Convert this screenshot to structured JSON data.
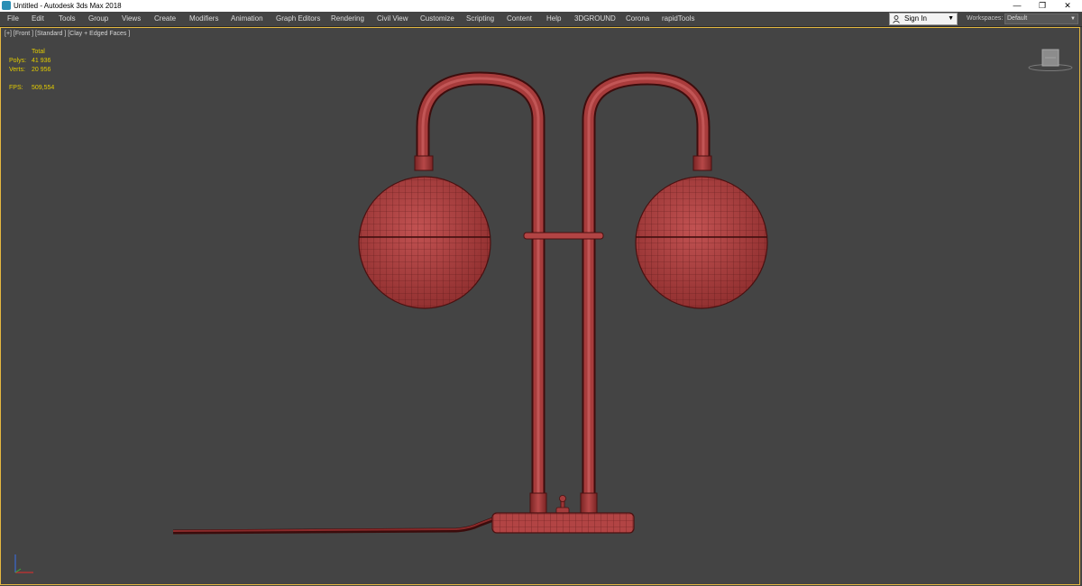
{
  "window": {
    "title": "Untitled - Autodesk 3ds Max 2018",
    "controls": {
      "minimize": "—",
      "restore": "❐",
      "close": "✕"
    }
  },
  "menu": {
    "items": [
      "File",
      "Edit",
      "Tools",
      "Group",
      "Views",
      "Create",
      "Modifiers",
      "Animation",
      "Graph Editors",
      "Rendering",
      "Civil View",
      "Customize",
      "Scripting",
      "Content",
      "Help",
      "3DGROUND",
      "Corona",
      "rapidTools"
    ],
    "sign_in": "Sign In",
    "workspaces_label": "Workspaces:",
    "workspaces_value": "Default"
  },
  "viewport": {
    "label": "[+] [Front ] [Standard ] [Clay + Edged Faces ]",
    "stats": {
      "total_header": "Total",
      "polys_label": "Polys:",
      "polys_value": "41 936",
      "verts_label": "Verts:",
      "verts_value": "20 956",
      "fps_label": "FPS:",
      "fps_value": "509,554"
    },
    "colors": {
      "background": "#444444",
      "active_border": "#e5b840",
      "stats_text": "#e3cc00",
      "clay": "#b84848",
      "wire": "#4a1010"
    }
  }
}
